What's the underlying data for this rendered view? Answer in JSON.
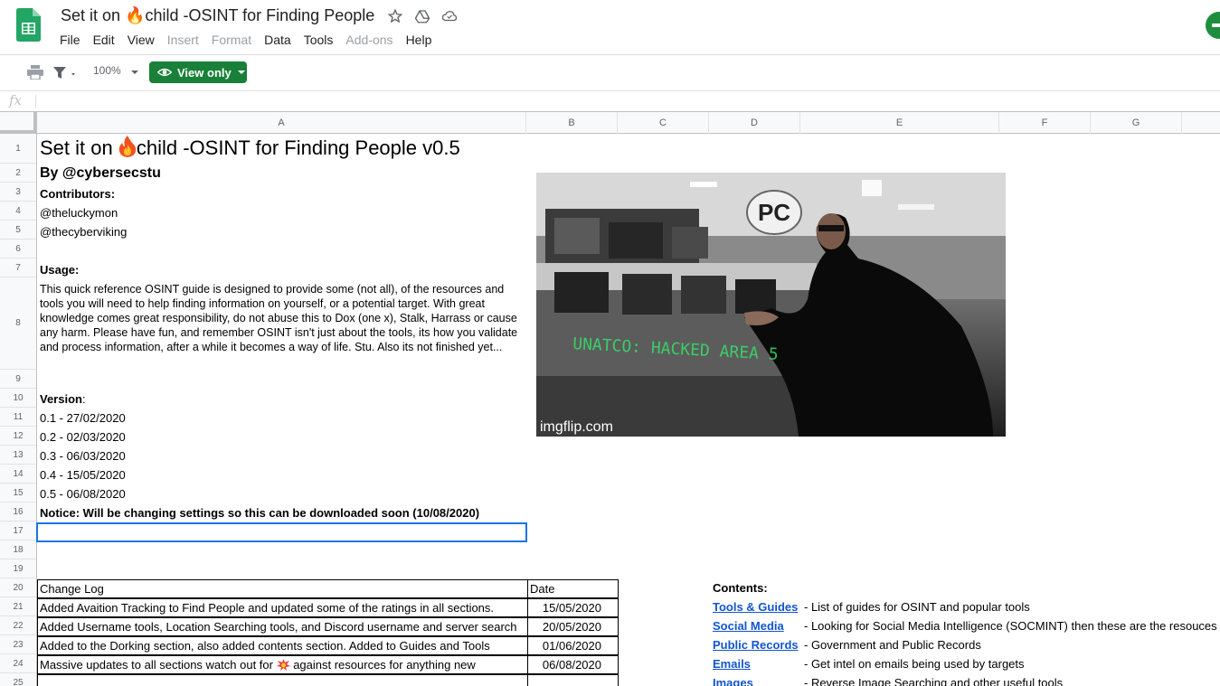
{
  "app": {
    "doc_title": "Set it on 🔥child -OSINT for Finding People",
    "menu": [
      {
        "label": "File",
        "disabled": false
      },
      {
        "label": "Edit",
        "disabled": false
      },
      {
        "label": "View",
        "disabled": false
      },
      {
        "label": "Insert",
        "disabled": true
      },
      {
        "label": "Format",
        "disabled": true
      },
      {
        "label": "Data",
        "disabled": false
      },
      {
        "label": "Tools",
        "disabled": false
      },
      {
        "label": "Add-ons",
        "disabled": true
      },
      {
        "label": "Help",
        "disabled": false
      }
    ],
    "accent_color": "#188038"
  },
  "toolbar": {
    "zoom": "100%",
    "view_only_label": "View only"
  },
  "formula_bar": {
    "fx_label": "fx"
  },
  "columns": [
    "A",
    "B",
    "C",
    "D",
    "E",
    "F",
    "G"
  ],
  "rows": [
    "1",
    "2",
    "3",
    "4",
    "5",
    "6",
    "7",
    "8",
    "9",
    "10",
    "11",
    "12",
    "13",
    "14",
    "15",
    "16",
    "17",
    "18",
    "19",
    "20",
    "21",
    "22",
    "23",
    "24",
    "25"
  ],
  "sheet": {
    "title_prefix": "Set it on ",
    "title_suffix": "child -OSINT for Finding People v0.5",
    "by": "By @cybersecstu",
    "contributors_label": "Contributors:",
    "contributors": [
      "@theluckymon",
      "@thecyberviking"
    ],
    "usage_label": "Usage:",
    "usage_text": "This quick reference OSINT guide is designed to provide some (not all), of the resources and tools you will need to help finding information on yourself, or a potential target. With great knowledge comes great responsibility, do not abuse this to Dox (one x), Stalk, Harrass or cause any harm. Please have fun, and remember OSINT isn't just about the tools, its how you validate and process information, after a while it becomes a way of life. Stu. Also its not finished yet...",
    "version_label": "Version",
    "version_colon": ":",
    "versions": [
      "0.1 - 27/02/2020",
      "0.2 - 02/03/2020",
      "0.3 - 06/03/2020",
      "0.4 - 15/05/2020",
      "0.5 - 06/08/2020"
    ],
    "notice": "Notice: Will be changing settings so this can be downloaded soon (10/08/2020)",
    "gif_watermark": "imgflip.com",
    "gif_sign": "PC",
    "gif_overlay": "UNATCO: HACKED AREA 5"
  },
  "changelog": {
    "header_a": "Change Log",
    "header_b": "Date",
    "rows": [
      {
        "text": "Added Avaition Tracking to Find People and updated some of the ratings in all sections.",
        "date": "15/05/2020"
      },
      {
        "text": "Added Username tools, Location Searching tools, and Discord username and server search",
        "date": "20/05/2020"
      },
      {
        "text": "Added to the Dorking section, also added contents section. Added to Guides and Tools",
        "date": "01/06/2020"
      },
      {
        "text_before": "Massive updates to all sections watch out for ",
        "text_after": " against resources for anything new",
        "date": "06/08/2020"
      }
    ]
  },
  "contents": {
    "title": "Contents:",
    "items": [
      {
        "link": "Tools & Guides",
        "desc": "- List of guides for OSINT and popular tools"
      },
      {
        "link": "Social Media ",
        "desc": "- Looking for Social Media Intelligence (SOCMINT) then these are the resouces"
      },
      {
        "link": "Public Records",
        "desc": "- Government and Public Records"
      },
      {
        "link": "Emails",
        "desc": "- Get intel on emails being used by targets"
      },
      {
        "link": "Images",
        "desc": "- Reverse Image Searching and other useful tools"
      }
    ]
  }
}
